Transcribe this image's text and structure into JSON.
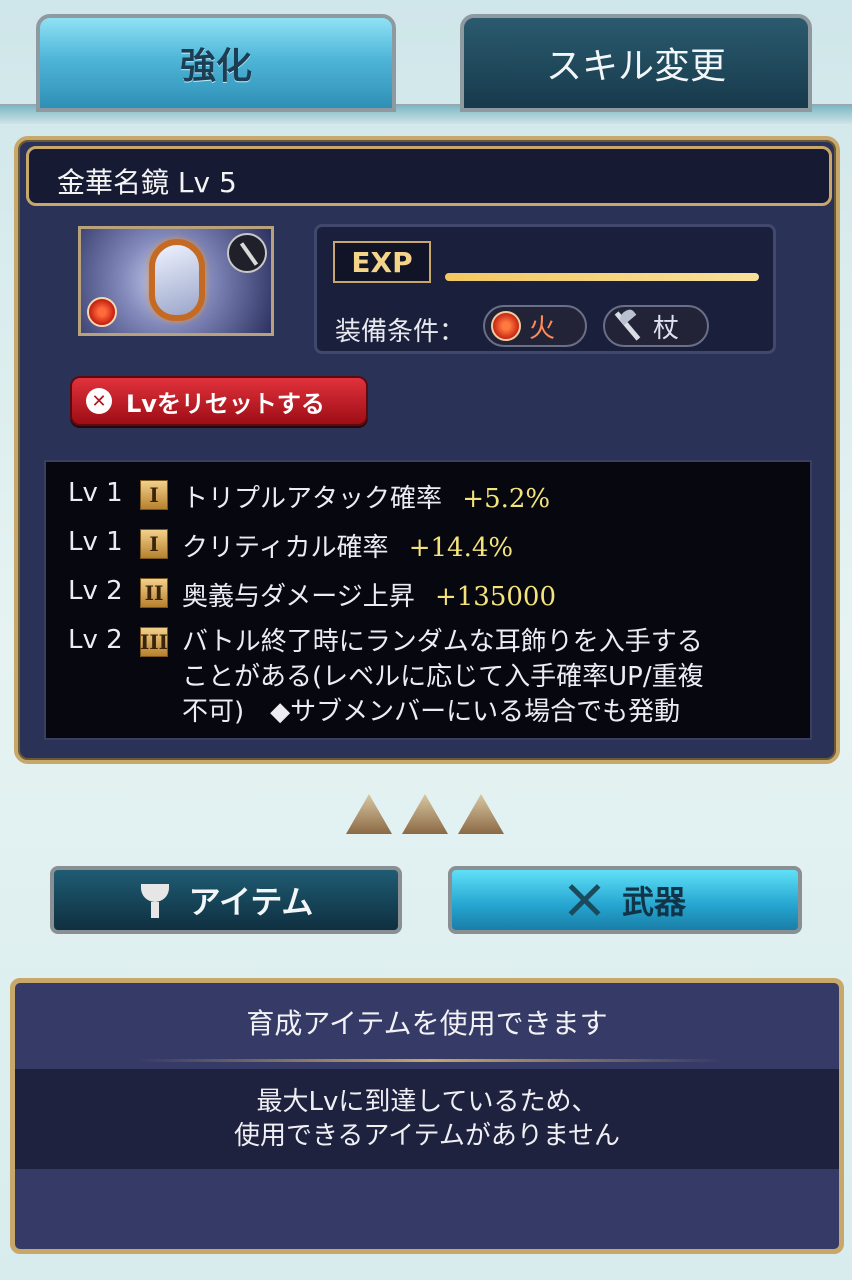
{
  "tabs": {
    "active": "強化",
    "inactive": "スキル変更"
  },
  "item": {
    "title": "金華名鏡 Lv 5",
    "exp_label": "EXP",
    "exp_progress": 1.0,
    "equip_label": "装備条件：",
    "element": "火",
    "weapon_type": "杖",
    "reset_label": "Lvをリセットする"
  },
  "skills": [
    {
      "lv": "Lv 1",
      "rank": "I",
      "name": "トリプルアタック確率",
      "value": "+5.2%"
    },
    {
      "lv": "Lv 1",
      "rank": "I",
      "name": "クリティカル確率",
      "value": "+14.4%"
    },
    {
      "lv": "Lv 2",
      "rank": "II",
      "name": "奥義与ダメージ上昇",
      "value": "+135000"
    },
    {
      "lv": "Lv 2",
      "rank": "III",
      "line1": "バトル終了時にランダムな耳飾りを入手する",
      "line2": "ことがある(レベルに応じて入手確率UP/重複",
      "line3": "不可)　◆サブメンバーにいる場合でも発動"
    }
  ],
  "buttons": {
    "item": "アイテム",
    "weapon": "武器"
  },
  "info": {
    "header": "育成アイテムを使用できます",
    "line1": "最大Lvに到達しているため、",
    "line2": "使用できるアイテムがありません"
  },
  "colors": {
    "accent_gold": "#c7a86a",
    "tab_active": "#4fb6d8",
    "reset_red": "#c71f29",
    "value_yellow": "#f4e27a"
  },
  "icons": [
    "mirror-image",
    "fire-element-icon",
    "staff-icon",
    "close-icon",
    "triangle-icon",
    "cup-icon",
    "swords-icon"
  ]
}
